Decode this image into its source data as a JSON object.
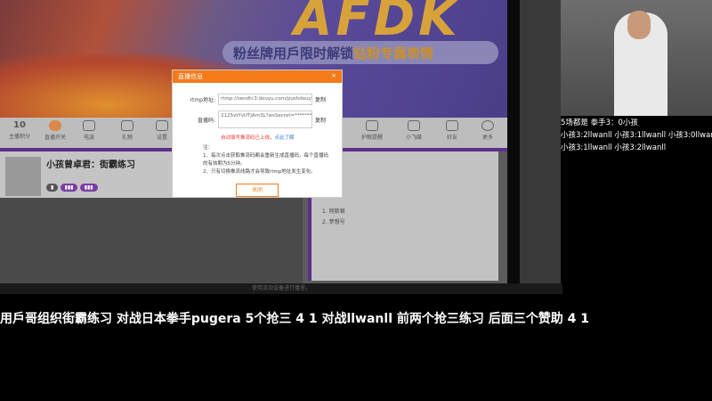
{
  "banner": {
    "big_text": "AFDK",
    "slogan_a": "粉丝牌用戶限时解锁",
    "slogan_b": "钻粉专属表情"
  },
  "nav": [
    {
      "label": "主播积分",
      "value": "10"
    },
    {
      "label": "直播开关"
    },
    {
      "label": "电波"
    },
    {
      "label": "礼物"
    },
    {
      "label": "设置"
    },
    {
      "label": "护眼提醒"
    },
    {
      "label": "小飞碟"
    },
    {
      "label": "好友"
    },
    {
      "label": "更多"
    }
  ],
  "room": {
    "title": "小孩曾卓君：街霸练习",
    "follow": "关注",
    "share": "分享",
    "side_title": "主播榜",
    "side_list": [
      "1. 阿斯顿",
      "2. 梦想号"
    ]
  },
  "dialog": {
    "title": "直播信息",
    "close_icon": "×",
    "rtmp_label": "rtmp地址:",
    "rtmp_value": "rtmp://sendtc3.douyu.com/pushdouyu",
    "code_label": "直播码:",
    "code_value": "2125vtYvUTjAm3L?wsSecret=**************",
    "copy": "复制",
    "warn": "自动填写推流码已上线，",
    "learn": "点此了解",
    "notes": [
      "注：",
      "1、每次点击获取推流码都会重新生成直播码，每个直播码的有效期为5分钟。",
      "2、只有切换推流线路才会导致rtmp地址发生变化。"
    ],
    "close_button": "关闭"
  },
  "infobar": "使用流动设备进行播里。",
  "overlay_lines": [
    "5场都是 拳手3：0小孩",
    "小孩3:2llwanll  小孩3:1llwanll  小孩3:0llwanll",
    "小孩3:1llwanll  小孩3:2llwanll"
  ],
  "subtitle": "用戶哥组织街霸练习  对战日本拳手pugera  5个抢三  4  1  对战llwanll  前两个抢三练习  后面三个赞助  4  1"
}
